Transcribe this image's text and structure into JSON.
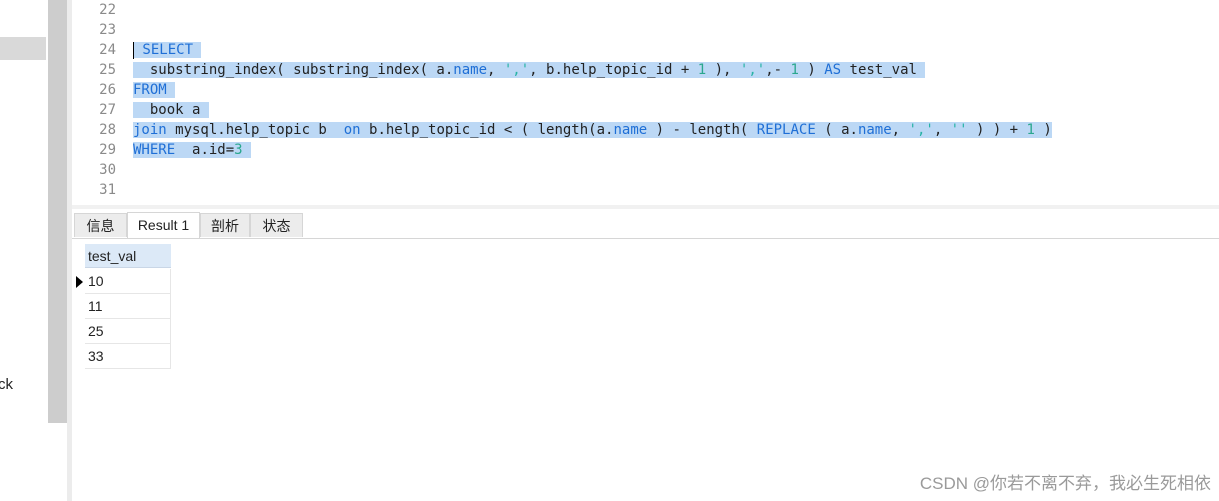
{
  "sidebar": {
    "partial_text": "ck"
  },
  "editor": {
    "line_numbers": [
      "22",
      "23",
      "24",
      "25",
      "26",
      "27",
      "28",
      "29",
      "30",
      "31"
    ],
    "lines": [
      [],
      [],
      [
        {
          "t": " SELECT ",
          "c": "kw"
        }
      ],
      [
        {
          "t": "  substring_index( substring_index( a.",
          "c": "fn"
        },
        {
          "t": "name",
          "c": "fld"
        },
        {
          "t": ", ",
          "c": "fn"
        },
        {
          "t": "','",
          "c": "str"
        },
        {
          "t": ", b.help_topic_id + ",
          "c": "fn"
        },
        {
          "t": "1",
          "c": "num"
        },
        {
          "t": " ), ",
          "c": "fn"
        },
        {
          "t": "','",
          "c": "str"
        },
        {
          "t": ",- ",
          "c": "fn"
        },
        {
          "t": "1",
          "c": "num"
        },
        {
          "t": " ) ",
          "c": "fn"
        },
        {
          "t": "AS",
          "c": "kw"
        },
        {
          "t": " test_val ",
          "c": "fn"
        }
      ],
      [
        {
          "t": "FROM",
          "c": "kw"
        },
        {
          "t": " ",
          "c": "fn"
        }
      ],
      [
        {
          "t": "  book a ",
          "c": "fn"
        }
      ],
      [
        {
          "t": "join",
          "c": "kw"
        },
        {
          "t": " mysql.help_topic b  ",
          "c": "fn"
        },
        {
          "t": "on",
          "c": "kw"
        },
        {
          "t": " b.help_topic_id < ( length(a.",
          "c": "fn"
        },
        {
          "t": "name",
          "c": "fld"
        },
        {
          "t": " ) - length( ",
          "c": "fn"
        },
        {
          "t": "REPLACE",
          "c": "kw"
        },
        {
          "t": " ( a.",
          "c": "fn"
        },
        {
          "t": "name",
          "c": "fld"
        },
        {
          "t": ", ",
          "c": "fn"
        },
        {
          "t": "','",
          "c": "str"
        },
        {
          "t": ", ",
          "c": "fn"
        },
        {
          "t": "''",
          "c": "str"
        },
        {
          "t": " ) ) + ",
          "c": "fn"
        },
        {
          "t": "1",
          "c": "num"
        },
        {
          "t": " )",
          "c": "fn"
        }
      ],
      [
        {
          "t": "WHERE",
          "c": "kw"
        },
        {
          "t": "  a.id=",
          "c": "fn"
        },
        {
          "t": "3",
          "c": "num"
        },
        {
          "t": " ",
          "c": "fn"
        }
      ],
      [],
      []
    ]
  },
  "tabs": [
    {
      "label": "信息",
      "active": false
    },
    {
      "label": "Result 1",
      "active": true
    },
    {
      "label": "剖析",
      "active": false
    },
    {
      "label": "状态",
      "active": false
    }
  ],
  "results": {
    "column": "test_val",
    "rows": [
      "10",
      "11",
      "25",
      "33"
    ],
    "current_row": 0
  },
  "watermark": "CSDN @你若不离不弃，我必生死相依",
  "colors": {
    "selection": "#bcd8f5",
    "keyword": "#1f6fd6",
    "string": "#27b3a6",
    "number": "#2aa78e",
    "header_bg": "#dce9f7"
  }
}
